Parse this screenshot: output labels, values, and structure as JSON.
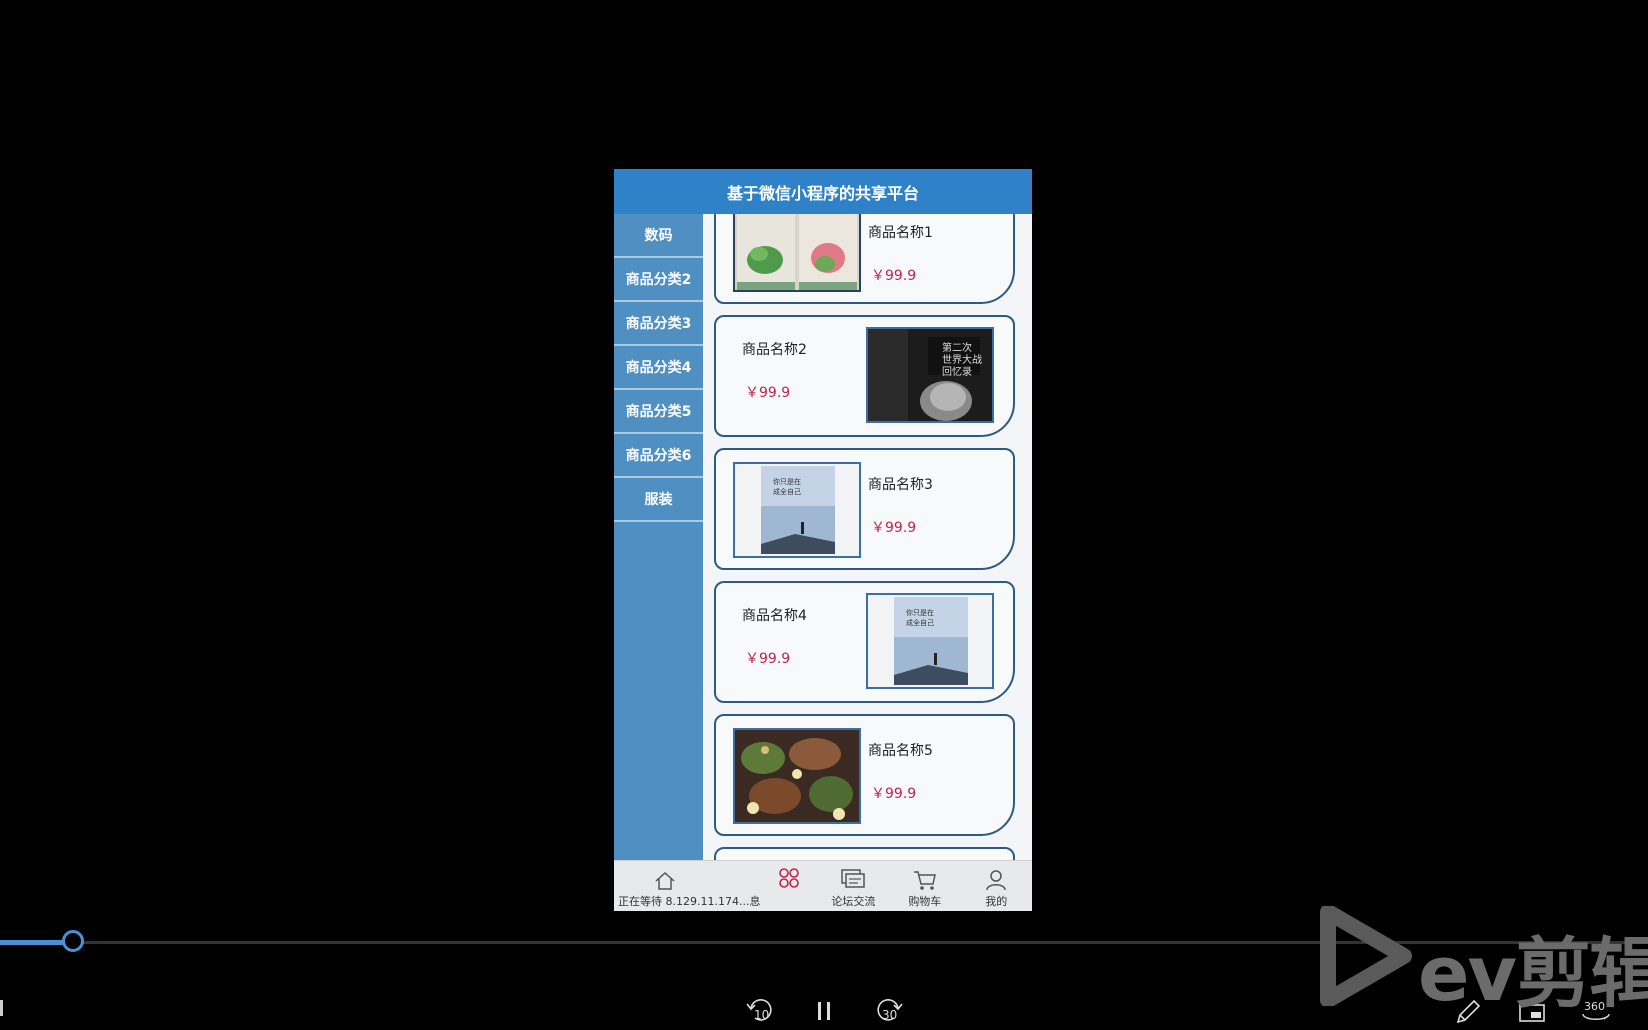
{
  "app": {
    "title": "基于微信小程序的共享平台"
  },
  "sidebar": {
    "categories": [
      {
        "label": "数码"
      },
      {
        "label": "商品分类2"
      },
      {
        "label": "商品分类3"
      },
      {
        "label": "商品分类4"
      },
      {
        "label": "商品分类5"
      },
      {
        "label": "商品分类6"
      },
      {
        "label": "服装"
      }
    ]
  },
  "products": [
    {
      "name": "商品名称1",
      "price": "￥99.9",
      "image": "plant-book-covers"
    },
    {
      "name": "商品名称2",
      "price": "￥99.9",
      "image": "ww2-memoir-cover"
    },
    {
      "name": "商品名称3",
      "price": "￥99.9",
      "image": "blue-book-cover"
    },
    {
      "name": "商品名称4",
      "price": "￥99.9",
      "image": "blue-book-cover"
    },
    {
      "name": "商品名称5",
      "price": "￥99.9",
      "image": "food-platter"
    }
  ],
  "tabbar": {
    "items": [
      {
        "label": "正在等待 8.129.11.174...息",
        "icon": "home-icon"
      },
      {
        "label": "",
        "icon": "category-icon"
      },
      {
        "label": "论坛交流",
        "icon": "forum-icon"
      },
      {
        "label": "购物车",
        "icon": "cart-icon"
      },
      {
        "label": "我的",
        "icon": "user-icon"
      }
    ]
  },
  "player": {
    "progress_fraction": 0.044,
    "rewind_label": "10",
    "forward_label": "30",
    "vr_label": "360",
    "watermark": "ev剪辑"
  },
  "colors": {
    "header": "#2f82c7",
    "sidebar": "#4f8fc2",
    "price": "#c0244b",
    "progress": "#4a90d9"
  }
}
